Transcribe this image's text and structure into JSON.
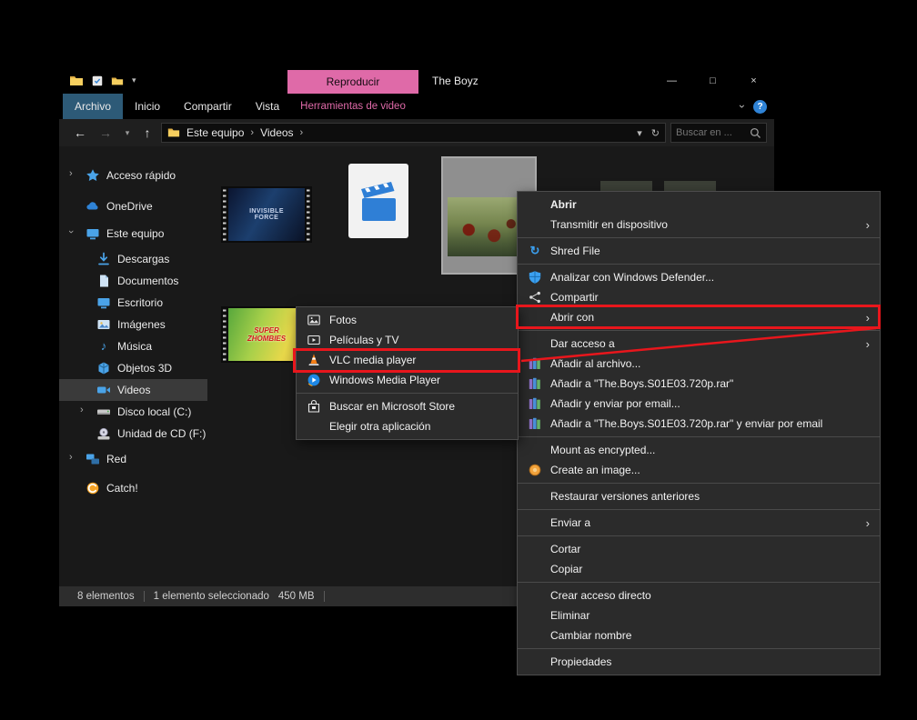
{
  "icons": {
    "back": "←",
    "forward": "→",
    "up": "↑",
    "refresh": "↻",
    "chevron": "›",
    "dropdown": "▾",
    "help": "?",
    "minimize": "—",
    "maximize": "□",
    "close": "×",
    "music": "♪"
  },
  "titlebar": {
    "title": "The Boyz",
    "tool_tab": "Reproducir"
  },
  "ribbon": {
    "tabs": [
      {
        "label": "Archivo"
      },
      {
        "label": "Inicio"
      },
      {
        "label": "Compartir"
      },
      {
        "label": "Vista"
      }
    ],
    "tool_label": "Herramientas de video"
  },
  "nav": {
    "root": "Este equipo",
    "folder": "Videos",
    "search_placeholder": "Buscar en ..."
  },
  "sidebar": {
    "items": [
      {
        "label": "Acceso rápido"
      },
      {
        "label": "OneDrive"
      },
      {
        "label": "Este equipo"
      },
      {
        "label": "Descargas"
      },
      {
        "label": "Documentos"
      },
      {
        "label": "Escritorio"
      },
      {
        "label": "Imágenes"
      },
      {
        "label": "Música"
      },
      {
        "label": "Objetos 3D"
      },
      {
        "label": "Videos"
      },
      {
        "label": "Disco local (C:)"
      },
      {
        "label": "Unidad de CD (F:)"
      },
      {
        "label": "Red"
      },
      {
        "label": "Catch!"
      }
    ]
  },
  "content": {
    "thumb_film1_text": "INVISIBLE FORCE",
    "thumb_film2_text": "SUPER ZHOMBIES"
  },
  "statusbar": {
    "count": "8 elementos",
    "selected": "1 elemento seleccionado",
    "size": "450 MB"
  },
  "context_menu": {
    "items": [
      {
        "label": "Abrir"
      },
      {
        "label": "Transmitir en dispositivo"
      },
      {
        "label": "Shred File"
      },
      {
        "label": "Analizar con Windows Defender..."
      },
      {
        "label": "Compartir"
      },
      {
        "label": "Abrir con"
      },
      {
        "label": "Dar acceso a"
      },
      {
        "label": "Añadir al archivo..."
      },
      {
        "label": "Añadir a \"The.Boys.S01E03.720p.rar\""
      },
      {
        "label": "Añadir y enviar por email..."
      },
      {
        "label": "Añadir a \"The.Boys.S01E03.720p.rar\" y enviar por email"
      },
      {
        "label": "Mount as encrypted..."
      },
      {
        "label": "Create an image..."
      },
      {
        "label": "Restaurar versiones anteriores"
      },
      {
        "label": "Enviar a"
      },
      {
        "label": "Cortar"
      },
      {
        "label": "Copiar"
      },
      {
        "label": "Crear acceso directo"
      },
      {
        "label": "Eliminar"
      },
      {
        "label": "Cambiar nombre"
      },
      {
        "label": "Propiedades"
      }
    ]
  },
  "submenu": {
    "items": [
      {
        "label": "Fotos"
      },
      {
        "label": "Películas y TV"
      },
      {
        "label": "VLC media player"
      },
      {
        "label": "Windows Media Player"
      },
      {
        "label": "Buscar en Microsoft Store"
      },
      {
        "label": "Elegir otra aplicación"
      }
    ]
  },
  "colors": {
    "accent_pink": "#df6aa8",
    "file_tab_blue": "#2d5a77",
    "annotation_red": "#e8161c"
  }
}
